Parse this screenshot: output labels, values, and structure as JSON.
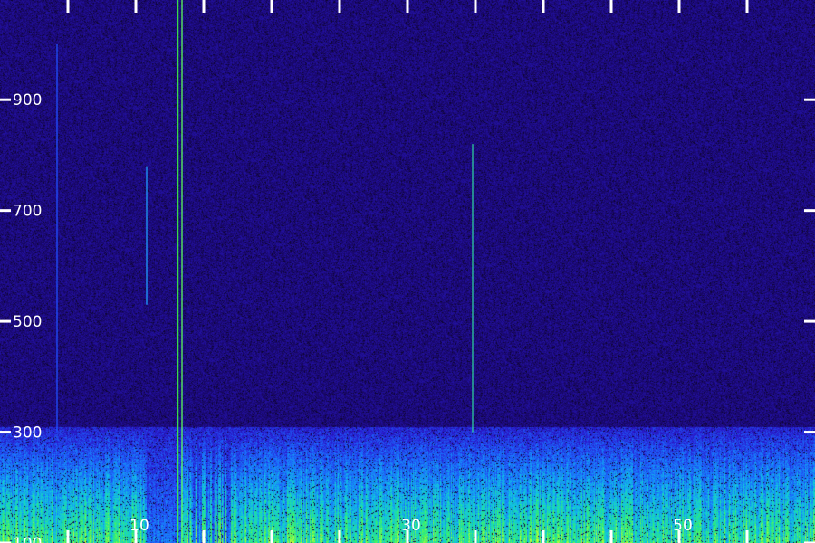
{
  "chart_data": {
    "type": "heatmap",
    "title": "",
    "xlabel": "",
    "ylabel": "",
    "x_tick_labels": [
      "10",
      "30",
      "50"
    ],
    "x_ticks": [
      10,
      30,
      50
    ],
    "x_minor_ticks": [
      5,
      10,
      15,
      20,
      25,
      30,
      35,
      40,
      45,
      50,
      55
    ],
    "xlim": [
      0,
      60
    ],
    "y_tick_labels": [
      "900",
      "700",
      "500",
      "300",
      "100"
    ],
    "y_ticks": [
      900,
      700,
      500,
      300,
      100
    ],
    "ylim": [
      100,
      1080
    ],
    "colormap": [
      "#0a0418",
      "#1a0870",
      "#2a1ad0",
      "#1a70ff",
      "#10c8e0",
      "#30f070",
      "#c8ff30"
    ],
    "background_color": "#1a0a5a",
    "low_band": {
      "y_max": 300,
      "intensity": "high"
    },
    "narrowband_lines": [
      {
        "x": 13.1,
        "y_from": 100,
        "y_to": 1080,
        "color": "#40ff40"
      },
      {
        "x": 13.4,
        "y_from": 100,
        "y_to": 1080,
        "color": "#60ff60"
      },
      {
        "x": 34.8,
        "y_from": 300,
        "y_to": 820,
        "color": "#30d0a0"
      },
      {
        "x": 10.8,
        "y_from": 530,
        "y_to": 780,
        "color": "#20a0ff"
      },
      {
        "x": 4.2,
        "y_from": 300,
        "y_to": 1000,
        "color": "#2050ff"
      }
    ],
    "grid": false
  }
}
